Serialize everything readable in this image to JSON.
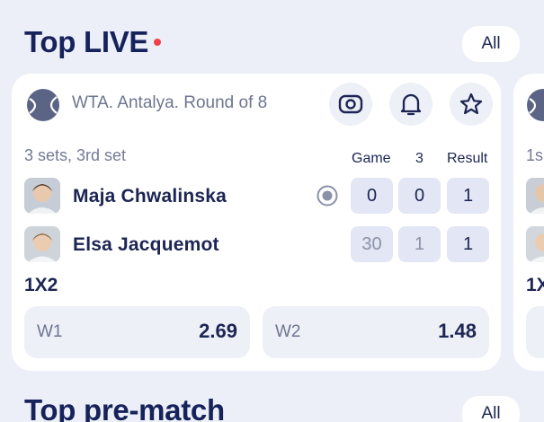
{
  "top_live": {
    "title": "Top LIVE",
    "all_label": "All",
    "match": {
      "league": "WTA. Antalya. Round of 8",
      "sets_info": "3 sets, 3rd set",
      "columns": [
        "Game",
        "3",
        "Result"
      ],
      "players": [
        {
          "name": "Maja Chwalinska",
          "game": "0",
          "set3": "0",
          "result": "1",
          "serving": true
        },
        {
          "name": "Elsa Jacquemot",
          "game": "30",
          "set3": "1",
          "result": "1",
          "serving": false
        }
      ],
      "market": "1X2",
      "odds": [
        {
          "label": "W1",
          "value": "2.69"
        },
        {
          "label": "W2",
          "value": "1.48"
        }
      ]
    },
    "next_card": {
      "sets_info": "1s",
      "market": "1X"
    }
  },
  "top_prematch": {
    "title": "Top pre-match",
    "all_label": "All"
  },
  "colors": {
    "background": "#eceff7",
    "title": "#16225a",
    "live_dot": "#f0414b",
    "score_chip": "#e3e6f4"
  }
}
